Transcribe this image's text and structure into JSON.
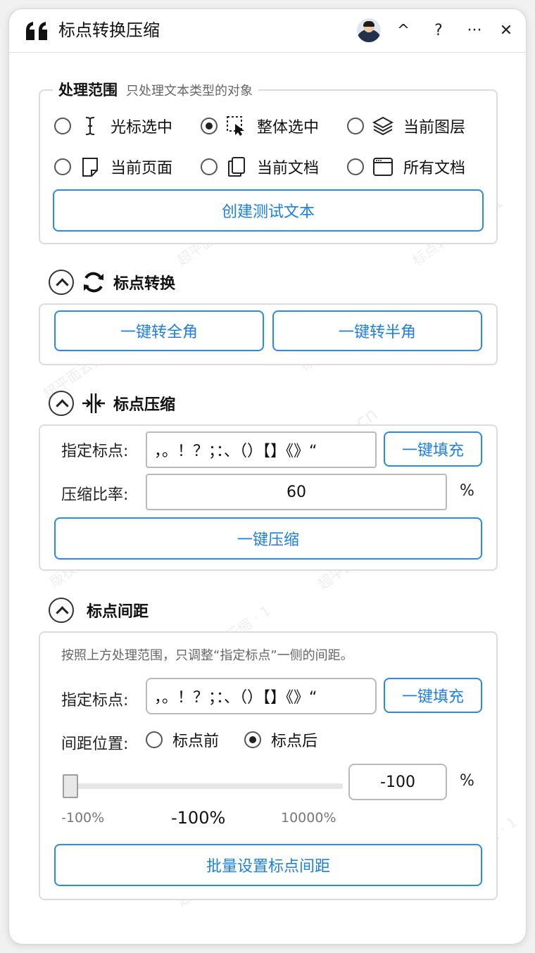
{
  "title": "标点转换压缩",
  "titlebar": {
    "collapse": "^",
    "help": "?",
    "more": "···",
    "close": "✕"
  },
  "scope": {
    "title": "处理范围",
    "subtitle": "只处理文本类型的对象",
    "options": [
      {
        "label": "光标选中",
        "icon": "text-cursor-icon",
        "selected": false
      },
      {
        "label": "整体选中",
        "icon": "selection-arrow-icon",
        "selected": true
      },
      {
        "label": "当前图层",
        "icon": "layers-icon",
        "selected": false
      },
      {
        "label": "当前页面",
        "icon": "page-icon",
        "selected": false
      },
      {
        "label": "当前文档",
        "icon": "document-icon",
        "selected": false
      },
      {
        "label": "所有文档",
        "icon": "window-icon",
        "selected": false
      }
    ],
    "create_button": "创建测试文本"
  },
  "convert": {
    "title": "标点转换",
    "full_button": "一键转全角",
    "half_button": "一键转半角"
  },
  "compress": {
    "title": "标点压缩",
    "punct_label": "指定标点:",
    "punct_value": "，。！？；：、（）【】《》“",
    "fill_button": "一键填充",
    "ratio_label": "压缩比率:",
    "ratio_value": "60",
    "unit": "%",
    "compress_button": "一键压缩"
  },
  "spacing": {
    "title": "标点间距",
    "hint": "按照上方处理范围，只调整“指定标点”一侧的间距。",
    "punct_label": "指定标点:",
    "punct_value": "，。！？；：、（）【】《》“",
    "fill_button": "一键填充",
    "position_label": "间距位置:",
    "position_options": [
      {
        "label": "标点前",
        "selected": false
      },
      {
        "label": "标点后",
        "selected": true
      }
    ],
    "slider_value": "-100",
    "slider_fraction": 0,
    "unit": "%",
    "slider_min": "-100%",
    "slider_current": "-100%",
    "slider_max": "10000%",
    "apply_button": "批量设置标点间距"
  },
  "watermarks": [
    "超平面云插件 · Zebe · 1",
    "版权所有 · 仿冒必究 · 1",
    "标点转换压缩 · 1",
    "超平面云插件 · zurocp.cn"
  ]
}
